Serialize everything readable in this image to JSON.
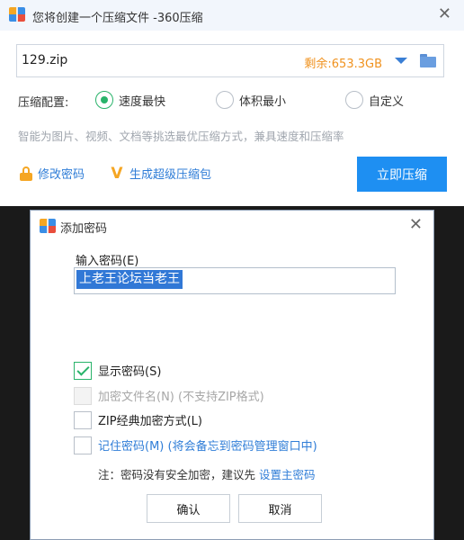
{
  "main_window": {
    "title": "您将创建一个压缩文件 -360压缩",
    "path": "129.zip",
    "free_space": "剩余:653.3GB",
    "config_label": "压缩配置:",
    "options": [
      {
        "label": "速度最快",
        "selected": true
      },
      {
        "label": "体积最小",
        "selected": false
      },
      {
        "label": "自定义",
        "selected": false
      }
    ],
    "description": "智能为图片、视频、文档等挑选最优压缩方式，兼具速度和压缩率",
    "change_password_link": "修改密码",
    "super_package_link": "生成超级压缩包",
    "compress_button": "立即压缩"
  },
  "dialog": {
    "title": "添加密码",
    "password_label": "输入密码(E)",
    "password_value": "上老王论坛当老王",
    "checkboxes": [
      {
        "label": "显示密码(S)",
        "checked": true,
        "disabled": false
      },
      {
        "label": "加密文件名(N) (不支持ZIP格式)",
        "checked": false,
        "disabled": true
      },
      {
        "label": "ZIP经典加密方式(L)",
        "checked": false,
        "disabled": false
      },
      {
        "label": "记住密码(M) (将会备忘到密码管理窗口中)",
        "checked": false,
        "disabled": false
      }
    ],
    "note_text": "注：密码没有安全加密，建议先 ",
    "note_link": "设置主密码",
    "ok_button": "确认",
    "cancel_button": "取消"
  },
  "colors": {
    "accent_blue": "#1e8ff2",
    "link_blue": "#2f7dd7",
    "check_green": "#29b36a",
    "free_space_orange": "#f0921e"
  }
}
